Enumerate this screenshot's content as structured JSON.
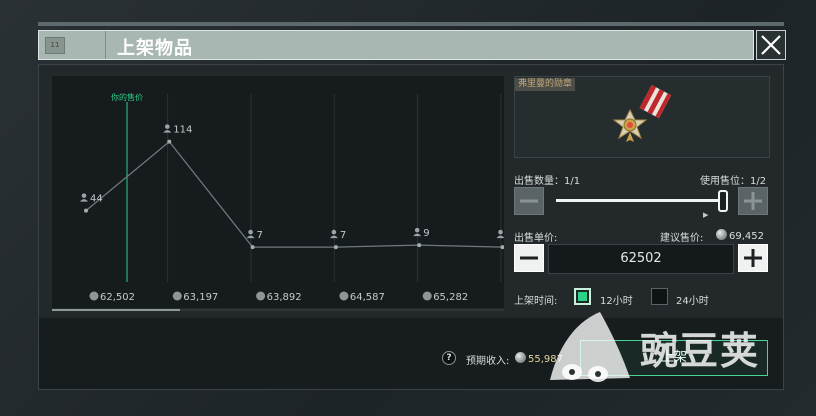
{
  "window": {
    "title": "上架物品",
    "grip_label": "11"
  },
  "chart_data": {
    "type": "line",
    "categories": [
      "62,502",
      "63,197",
      "63,892",
      "64,587",
      "65,282",
      ""
    ],
    "series": [
      {
        "values": [
          44,
          114,
          7,
          7,
          9,
          7
        ]
      }
    ],
    "value_labels": [
      "44",
      "114",
      "7",
      "7",
      "9",
      ""
    ],
    "marker_label": "你的售价",
    "ylim": [
      0,
      140
    ],
    "grid": true
  },
  "item": {
    "name": "弗里曼的勋章"
  },
  "quantity": {
    "label": "出售数量：1/1",
    "slots_label": "使用售位：1/2",
    "minus_symbol": "−",
    "plus_symbol": "+",
    "fill_fraction": 1.0
  },
  "price": {
    "label": "出售单价:",
    "suggested_label": "建议售价:",
    "suggested_value": "69,452",
    "value": "62502",
    "minus_symbol": "−",
    "plus_symbol": "+"
  },
  "duration": {
    "label": "上架时间:",
    "options": [
      {
        "label": "12小时",
        "selected": true
      },
      {
        "label": "24小时",
        "selected": false
      }
    ]
  },
  "footer": {
    "help_symbol": "?",
    "income_label": "预期收入:",
    "income_value": "55,987",
    "list_button": "上架"
  },
  "watermark": {
    "text": "豌豆荚"
  },
  "colors": {
    "accent": "#2bd28a",
    "income": "#e8d79a",
    "item_name": "#c6a77a",
    "marker_line": "#2bd28a"
  }
}
